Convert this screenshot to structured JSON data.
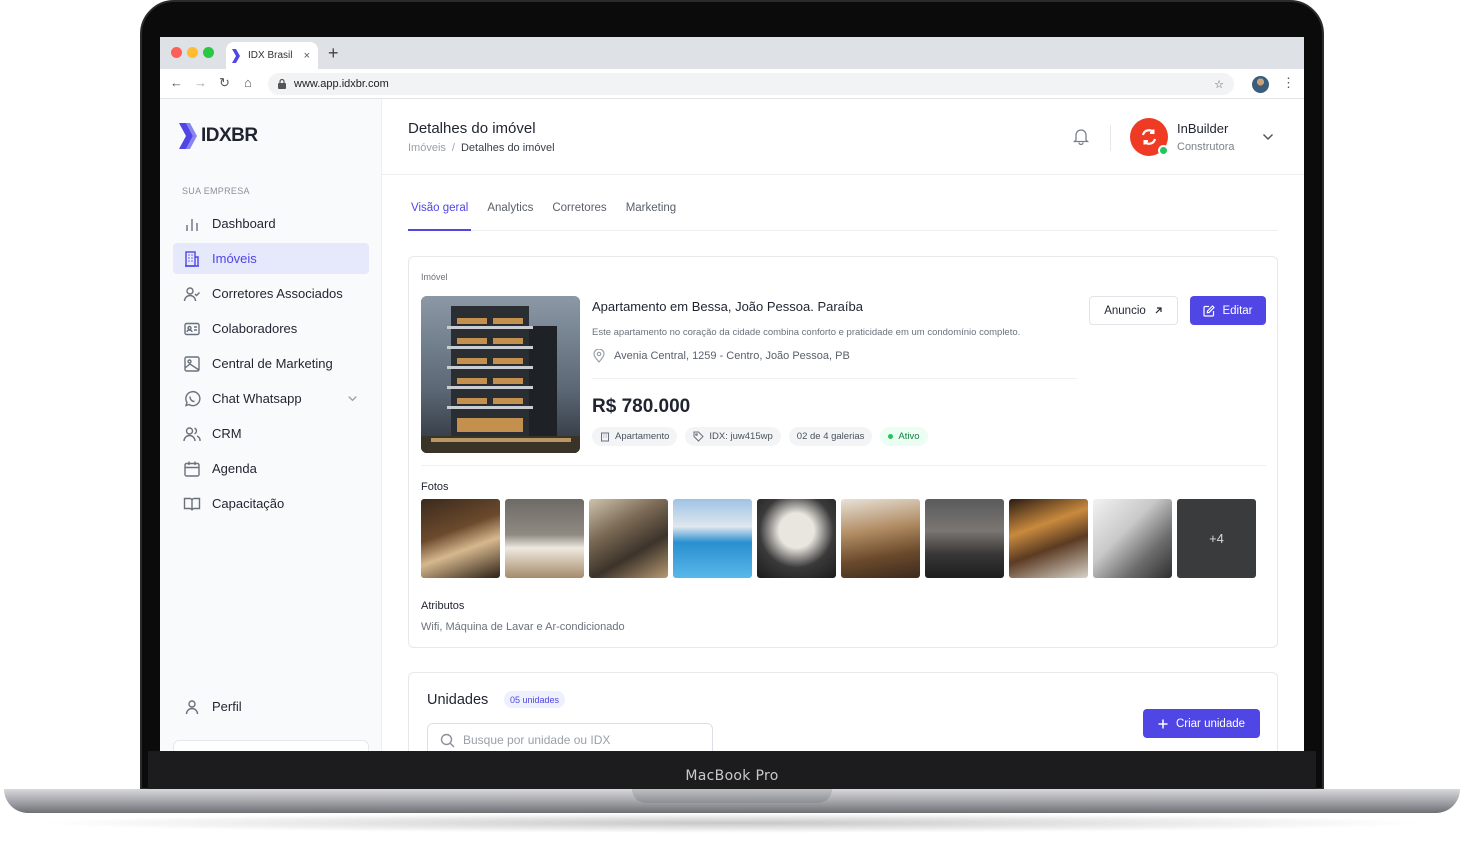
{
  "device": {
    "label": "MacBook Pro"
  },
  "browser": {
    "tab_title": "IDX Brasil",
    "tab_close": "×",
    "new_tab": "+",
    "url": "www.app.idxbr.com"
  },
  "sidebar": {
    "logo_text": "IDXBR",
    "section_label": "SUA EMPRESA",
    "items": [
      {
        "label": "Dashboard",
        "icon": "bar-chart-icon"
      },
      {
        "label": "Imóveis",
        "icon": "building-icon",
        "active": true
      },
      {
        "label": "Corretores Associados",
        "icon": "user-check-icon"
      },
      {
        "label": "Colaboradores",
        "icon": "id-card-icon"
      },
      {
        "label": "Central de Marketing",
        "icon": "image-icon"
      },
      {
        "label": "Chat Whatsapp",
        "icon": "whatsapp-icon",
        "expandable": true
      },
      {
        "label": "CRM",
        "icon": "users-icon"
      },
      {
        "label": "Agenda",
        "icon": "calendar-icon"
      },
      {
        "label": "Capacitação",
        "icon": "book-icon"
      }
    ],
    "profile_label": "Perfil"
  },
  "header": {
    "title": "Detalhes do imóvel",
    "breadcrumb": [
      "Imóveis",
      "/",
      "Detalhes do imóvel"
    ],
    "user_name": "InBuilder",
    "user_role": "Construtora"
  },
  "tabs": [
    "Visão geral",
    "Analytics",
    "Corretores",
    "Marketing"
  ],
  "property": {
    "card_label": "Imóvel",
    "title": "Apartamento em Bessa, João Pessoa. Paraíba",
    "description": "Este apartamento no coração da cidade combina conforto e praticidade em um condomínio completo.",
    "address": "Avenia Central, 1259 - Centro, João Pessoa, PB",
    "price": "R$ 780.000",
    "chips": {
      "type": "Apartamento",
      "idx": "IDX: juw415wp",
      "galleries": "02 de 4 galerias",
      "status": "Ativo"
    },
    "anuncio_label": "Anuncio",
    "editar_label": "Editar",
    "photos_label": "Fotos",
    "photos_more": "+4",
    "attributes_label": "Atributos",
    "attributes_value": "Wifi, Máquina de Lavar e Ar-condicionado"
  },
  "units": {
    "title": "Unidades",
    "badge": "05 unidades",
    "search_placeholder": "Busque por unidade ou IDX",
    "create_label": "Criar unidade"
  },
  "colors": {
    "accent": "#4f46e5",
    "brand_red": "#ef3b24",
    "online": "#22c55e"
  }
}
